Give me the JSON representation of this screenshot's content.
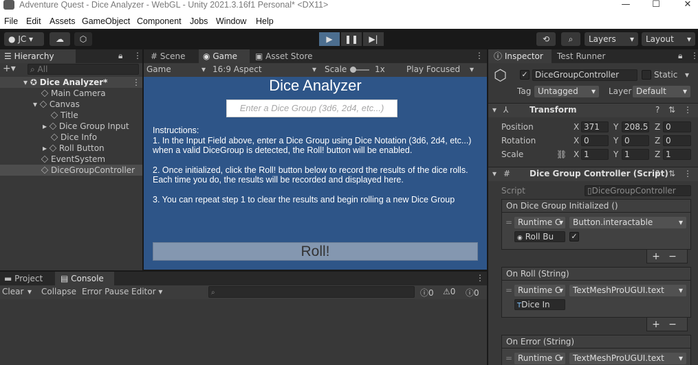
{
  "window": {
    "title": "Adventure Quest - Dice Analyzer - WebGL - Unity 2021.3.16f1 Personal* <DX11>"
  },
  "menu": [
    "File",
    "Edit",
    "Assets",
    "GameObject",
    "Component",
    "Jobs",
    "Window",
    "Help"
  ],
  "toolbar": {
    "account": "JC",
    "layers": "Layers",
    "layout": "Layout"
  },
  "hierarchy": {
    "tab": "Hierarchy",
    "search_placeholder": "All",
    "scene": "Dice Analyzer*",
    "items": [
      {
        "label": "Main Camera"
      },
      {
        "label": "Canvas"
      },
      {
        "label": "Title"
      },
      {
        "label": "Dice Group Input"
      },
      {
        "label": "Dice Info"
      },
      {
        "label": "Roll Button"
      },
      {
        "label": "EventSystem"
      },
      {
        "label": "DiceGroupController"
      }
    ]
  },
  "center": {
    "tabs": [
      "Scene",
      "Game",
      "Asset Store"
    ],
    "display": "Game",
    "aspect": "16:9 Aspect",
    "scale_label": "Scale",
    "scale_value": "1x",
    "play_focused": "Play Focused"
  },
  "game": {
    "title": "Dice Analyzer",
    "input_placeholder": "Enter a Dice Group (3d6, 2d4, etc...)",
    "instructions_heading": "Instructions:",
    "step1a": "1. In the Input Field above, enter a Dice Group using Dice Notation (3d6, 2d4, etc...)",
    "step1b": "when a valid DiceGroup is detected, the Roll! button will be enabled.",
    "step2a": "2. Once initialized, click the Roll! button below to record the results of the dice rolls.",
    "step2b": "Each time you do, the results will be recorded and displayed here.",
    "step3": "3. You can repeat step 1 to clear the results and begin rolling a new Dice Group",
    "roll_button": "Roll!"
  },
  "bottom": {
    "tabs": [
      "Project",
      "Console"
    ],
    "clear": "Clear",
    "collapse": "Collapse",
    "error_pause": "Error Pause",
    "editor": "Editor",
    "count_log": "0",
    "count_warn": "0",
    "count_error": "0"
  },
  "inspector": {
    "tabs": [
      "Inspector",
      "Test Runner"
    ],
    "object_name": "DiceGroupController",
    "static_label": "Static",
    "tag_label": "Tag",
    "tag_value": "Untagged",
    "layer_label": "Layer",
    "layer_value": "Default",
    "transform": {
      "title": "Transform",
      "position_label": "Position",
      "rotation_label": "Rotation",
      "scale_label": "Scale",
      "position": [
        "371",
        "208.5",
        "0"
      ],
      "rotation": [
        "0",
        "0",
        "0"
      ],
      "scale": [
        "1",
        "1",
        "1"
      ],
      "axis": [
        "X",
        "Y",
        "Z"
      ]
    },
    "script_component": {
      "title": "Dice Group Controller (Script)",
      "script_label": "Script",
      "script_value": "DiceGroupController",
      "events": [
        {
          "name": "On Dice Group Initialized ()",
          "runtime": "Runtime C",
          "function": "Button.interactable",
          "target": "Roll Bu",
          "checked": true
        },
        {
          "name": "On Roll (String)",
          "runtime": "Runtime C",
          "function": "TextMeshProUGUI.text",
          "target": "Dice In"
        },
        {
          "name": "On Error (String)",
          "runtime": "Runtime C",
          "function": "TextMeshProUGUI.text"
        }
      ]
    }
  }
}
